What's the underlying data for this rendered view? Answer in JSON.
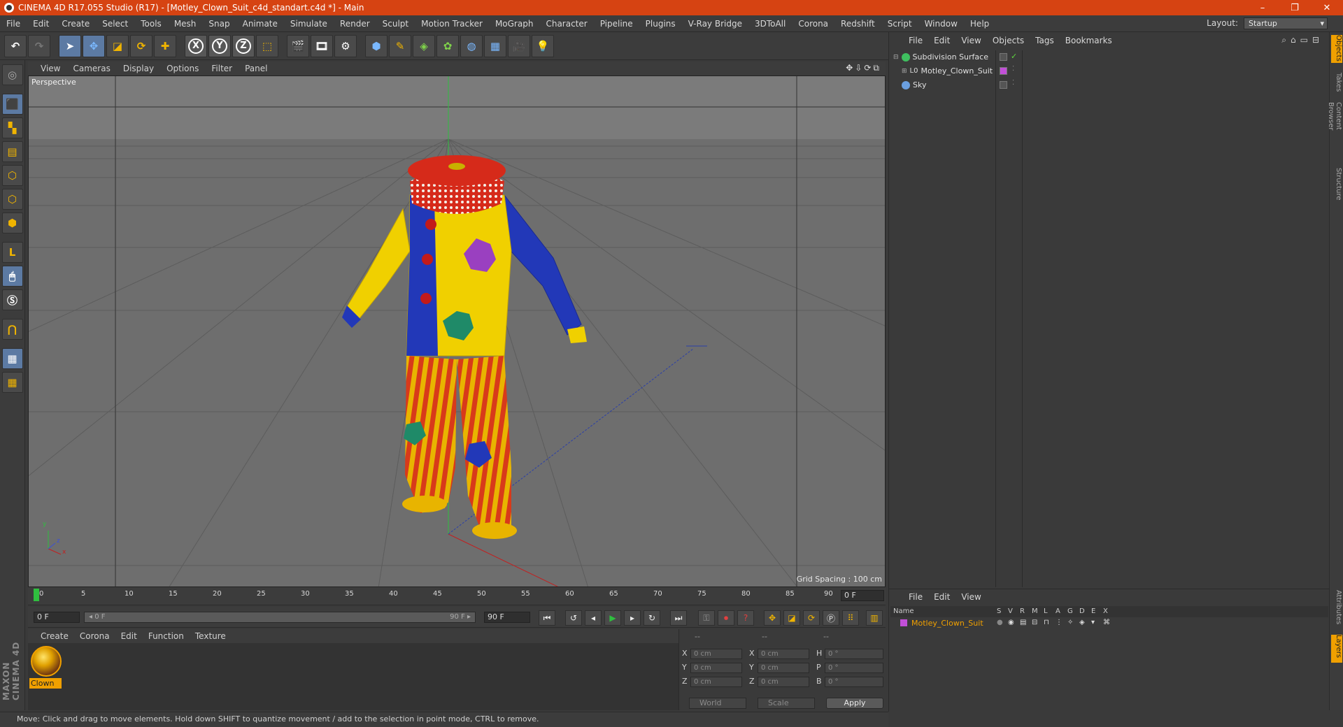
{
  "window": {
    "title": "CINEMA 4D R17.055 Studio (R17) - [Motley_Clown_Suit_c4d_standart.c4d *] - Main",
    "controls": [
      "–",
      "❐",
      "✕"
    ]
  },
  "menubar": {
    "items": [
      "File",
      "Edit",
      "Create",
      "Select",
      "Tools",
      "Mesh",
      "Snap",
      "Animate",
      "Simulate",
      "Render",
      "Sculpt",
      "Motion Tracker",
      "MoGraph",
      "Character",
      "Pipeline",
      "Plugins",
      "V-Ray Bridge",
      "3DToAll",
      "Corona",
      "Redshift",
      "Script",
      "Window",
      "Help"
    ],
    "layout_label": "Layout:",
    "layout_value": "Startup"
  },
  "toolbar": {
    "undo": "↶",
    "redo": "↷",
    "axis_x": "X",
    "axis_y": "Y",
    "axis_z": "Z"
  },
  "viewport": {
    "menu": [
      "View",
      "Cameras",
      "Display",
      "Options",
      "Filter",
      "Panel"
    ],
    "label": "Perspective",
    "grid_spacing": "Grid Spacing : 100 cm",
    "nav_icons": "✥⇩⟳⧉",
    "axis_y": "y",
    "axis_x": "x",
    "axis_z": "z"
  },
  "timeline": {
    "ticks": [
      "0",
      "5",
      "10",
      "15",
      "20",
      "25",
      "30",
      "35",
      "40",
      "45",
      "50",
      "55",
      "60",
      "65",
      "70",
      "75",
      "80",
      "85",
      "90"
    ],
    "current_frame": "0 F"
  },
  "transport": {
    "start": "0 F",
    "slider_start": "◂ 0 F",
    "slider_end": "90 F ▸",
    "end": "90 F"
  },
  "material_manager": {
    "menu": [
      "Create",
      "Corona",
      "Edit",
      "Function",
      "Texture"
    ],
    "materials": [
      {
        "name": "Clown"
      }
    ]
  },
  "coordinates": {
    "headers": [
      "--",
      "--",
      "--"
    ],
    "rows": [
      {
        "l1": "X",
        "v1": "0 cm",
        "l2": "X",
        "v2": "0 cm",
        "l3": "H",
        "v3": "0 °"
      },
      {
        "l1": "Y",
        "v1": "0 cm",
        "l2": "Y",
        "v2": "0 cm",
        "l3": "P",
        "v3": "0 °"
      },
      {
        "l1": "Z",
        "v1": "0 cm",
        "l2": "Z",
        "v2": "0 cm",
        "l3": "B",
        "v3": "0 °"
      }
    ],
    "mode": "World",
    "transform": "Scale",
    "apply": "Apply"
  },
  "status": "Move: Click and drag to move elements. Hold down SHIFT to quantize movement / add to the selection in point mode, CTRL to remove.",
  "objects": {
    "menu": [
      "File",
      "Edit",
      "View",
      "Objects",
      "Tags",
      "Bookmarks"
    ],
    "items": [
      {
        "name": "Subdivision Surface",
        "icon_color": "#3fbf5f"
      },
      {
        "name": "Motley_Clown_Suit",
        "icon_color": "#c24fd8"
      },
      {
        "name": "Sky",
        "icon_color": "#6a9fe0"
      }
    ]
  },
  "right_tabs": [
    "Objects",
    "Takes",
    "Content Browser",
    "Structure"
  ],
  "right_tabs_lower": [
    "Attributes",
    "Layers"
  ],
  "layers": {
    "menu": [
      "File",
      "Edit",
      "View"
    ],
    "columns": [
      "Name",
      "S",
      "V",
      "R",
      "M",
      "L",
      "A",
      "G",
      "D",
      "E",
      "X"
    ],
    "rows": [
      {
        "name": "Motley_Clown_Suit",
        "color": "#c24fd8"
      }
    ]
  },
  "brand": {
    "logo_text": "MAXON CINEMA 4D"
  },
  "colors": {
    "accent": "#f0a000",
    "titlebar": "#d64312",
    "selected_tool": "#5c7aa3"
  }
}
